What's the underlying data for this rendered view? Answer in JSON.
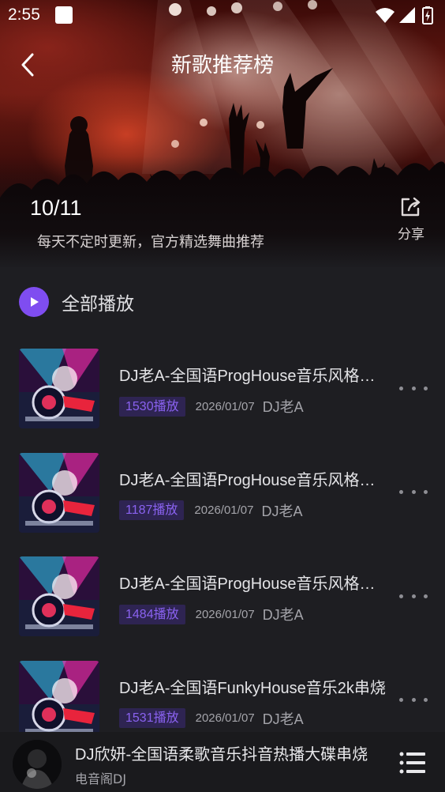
{
  "status_bar": {
    "time": "2:55",
    "icons": [
      "notification-square-icon",
      "wifi-icon",
      "signal-icon",
      "battery-icon"
    ]
  },
  "header": {
    "title": "新歌推荐榜",
    "back_icon": "chevron-left-icon"
  },
  "banner": {
    "date": "10/11",
    "subtitle": "每天不定时更新，官方精选舞曲推荐",
    "share_label": "分享",
    "share_icon": "share-icon"
  },
  "play_all": {
    "label": "全部播放",
    "icon": "play-icon",
    "accent_color": "#7f4df0"
  },
  "songs": [
    {
      "title": "DJ老A-全国语ProgHouse音乐风格串烧",
      "plays": "1530播放",
      "date": "2026/01/07",
      "artist": "DJ老A"
    },
    {
      "title": "DJ老A-全国语ProgHouse音乐风格串烧",
      "plays": "1187播放",
      "date": "2026/01/07",
      "artist": "DJ老A"
    },
    {
      "title": "DJ老A-全国语ProgHouse音乐风格串烧",
      "plays": "1484播放",
      "date": "2026/01/07",
      "artist": "DJ老A"
    },
    {
      "title": "DJ老A-全国语FunkyHouse音乐2k串烧",
      "plays": "1531播放",
      "date": "2026/01/07",
      "artist": "DJ老A"
    }
  ],
  "mini_player": {
    "title": "DJ欣妍-全国语柔歌音乐抖音热播大碟串烧",
    "subtitle": "电音阁DJ",
    "playlist_icon": "playlist-icon"
  },
  "colors": {
    "background": "#1e1e22",
    "accent": "#7f4df0",
    "badge_text": "#8a62f0",
    "badge_bg": "#2e2452"
  }
}
